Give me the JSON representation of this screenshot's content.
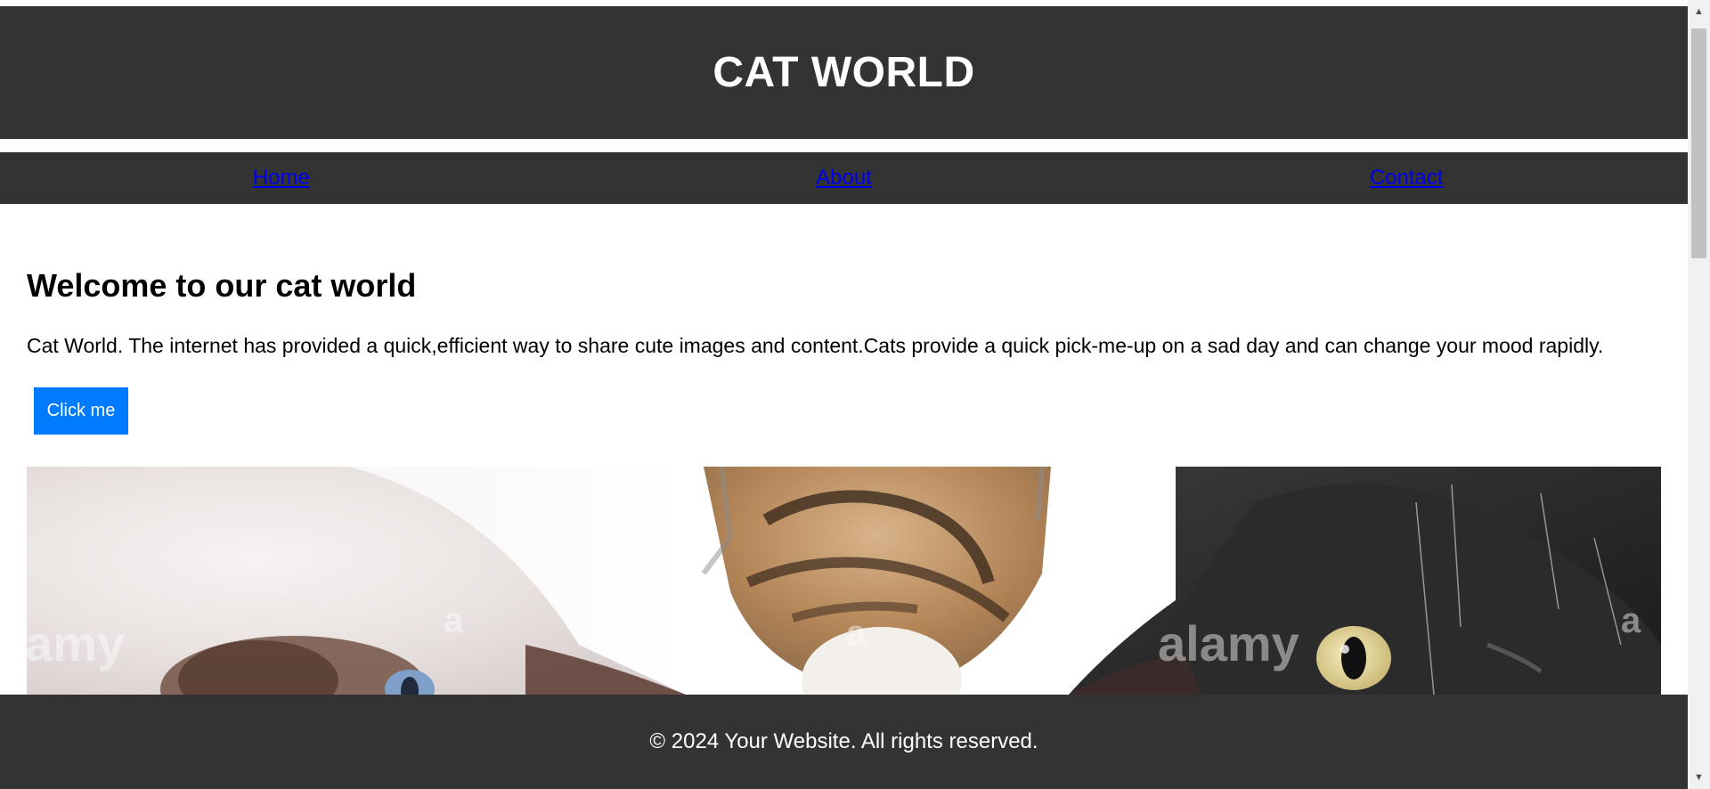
{
  "header": {
    "title": "CAT WORLD"
  },
  "nav": {
    "items": [
      {
        "label": "Home"
      },
      {
        "label": "About"
      },
      {
        "label": "Contact"
      }
    ]
  },
  "main": {
    "heading": "Welcome to our cat world",
    "intro": "Cat World. The internet has provided a quick,efficient way to share cute images and content.Cats provide a quick pick-me-up on a sad day and can change your mood rapidly.",
    "button_label": "Click me"
  },
  "image": {
    "watermark": "alamy",
    "watermark_letter": "a"
  },
  "footer": {
    "text": "© 2024 Your Website. All rights reserved."
  },
  "colors": {
    "header_bg": "#333333",
    "button_bg": "#007bff",
    "link": "#0000ee"
  }
}
